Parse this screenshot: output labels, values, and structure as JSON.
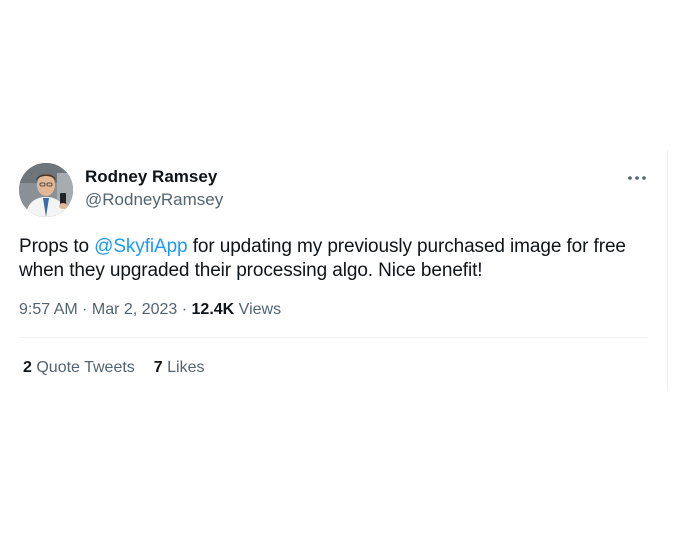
{
  "tweet": {
    "author": {
      "display_name": "Rodney Ramsey",
      "handle": "@RodneyRamsey",
      "avatar_icon": "profile-photo"
    },
    "more_icon": "more-horizontal-icon",
    "text": {
      "before_mention": "Props to ",
      "mention": "@SkyfiApp",
      "after_mention": " for updating my previously purchased image for free when they upgraded their processing algo. Nice benefit!"
    },
    "meta": {
      "time": "9:57 AM",
      "separator_1": " · ",
      "date": "Mar 2, 2023",
      "separator_2": " · ",
      "views_count": "12.4K",
      "views_label": " Views"
    },
    "stats": {
      "quote_tweets_count": "2",
      "quote_tweets_label": " Quote Tweets",
      "likes_count": "7",
      "likes_label": " Likes"
    }
  },
  "colors": {
    "text_primary": "#0f1419",
    "text_secondary": "#536471",
    "link": "#1d9bf0",
    "divider": "#eff3f4"
  }
}
